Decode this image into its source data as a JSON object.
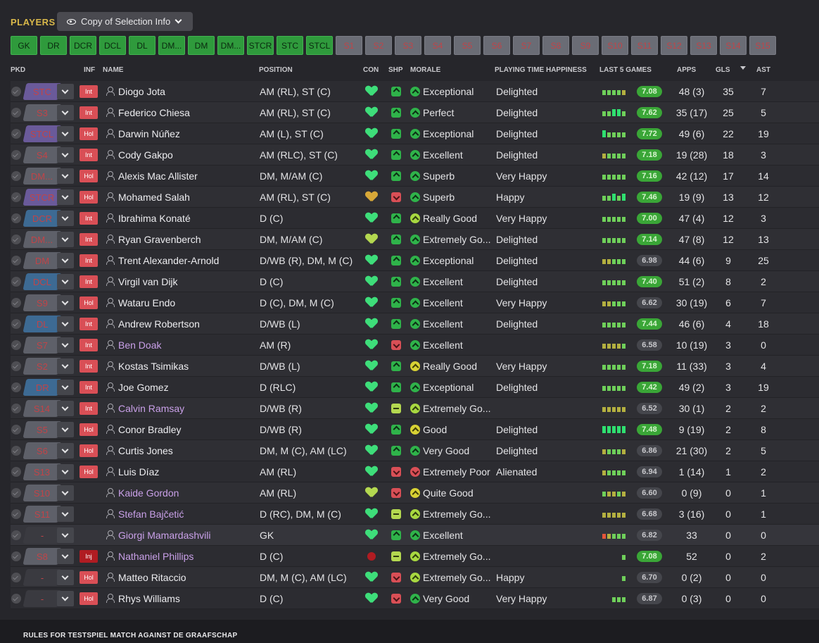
{
  "header_bar": {
    "title": "PLAYERS",
    "view_label": "Copy of Selection Info"
  },
  "positions": [
    "GK",
    "DR",
    "DCR",
    "DCL",
    "DL",
    "DM...",
    "DM",
    "DM...",
    "STCR",
    "STC",
    "STCL"
  ],
  "subs": [
    "S1",
    "S2",
    "S3",
    "S4",
    "S5",
    "S6",
    "S7",
    "S8",
    "S9",
    "S10",
    "S11",
    "S12",
    "S13",
    "S14",
    "S15"
  ],
  "columns": {
    "pkd": "PKD",
    "inf": "INF",
    "name": "NAME",
    "position": "POSITION",
    "con": "CON",
    "shp": "SHP",
    "morale": "MORALE",
    "pth": "PLAYING TIME HAPPINESS",
    "last5": "LAST 5 GAMES",
    "apps": "APPS",
    "gls": "GLS",
    "ast": "AST"
  },
  "colors": {
    "accent": "#d9b84a",
    "slot_green": "#2f9a3c",
    "slot_sub": "#6a6c75",
    "rating_good": "#3aa637",
    "loan_name": "#c9a0e8"
  },
  "players": [
    {
      "slot": "STC",
      "slot_color": "purple",
      "inf": "Int",
      "name": "Diogo Jota",
      "loan": false,
      "position": "AM (RL), ST (C)",
      "con": "green",
      "shp": "up",
      "mor_icon": "green",
      "morale": "Exceptional",
      "pth": "Delighted",
      "form": [
        4,
        4,
        4,
        4,
        3
      ],
      "rating": "7.08",
      "rating_good": true,
      "apps": "48 (3)",
      "gls": "35",
      "ast": "7"
    },
    {
      "slot": "S3",
      "slot_color": "grey",
      "inf": "Int",
      "name": "Federico Chiesa",
      "loan": false,
      "position": "AM (RL), ST (C)",
      "con": "green",
      "shp": "up",
      "mor_icon": "green",
      "morale": "Perfect",
      "pth": "Delighted",
      "form": [
        4,
        4,
        5,
        5,
        4
      ],
      "rating": "7.62",
      "rating_good": true,
      "apps": "35 (17)",
      "gls": "25",
      "ast": "5"
    },
    {
      "slot": "STCL",
      "slot_color": "purple",
      "inf": "Hol",
      "name": "Darwin Núñez",
      "loan": false,
      "position": "AM (L), ST (C)",
      "con": "green",
      "shp": "up",
      "mor_icon": "green",
      "morale": "Exceptional",
      "pth": "Delighted",
      "form": [
        5,
        4,
        4,
        4,
        4
      ],
      "rating": "7.72",
      "rating_good": true,
      "apps": "49 (6)",
      "gls": "22",
      "ast": "19"
    },
    {
      "slot": "S4",
      "slot_color": "grey",
      "inf": "Int",
      "name": "Cody Gakpo",
      "loan": false,
      "position": "AM (RLC), ST (C)",
      "con": "green",
      "shp": "up",
      "mor_icon": "green",
      "morale": "Excellent",
      "pth": "Delighted",
      "form": [
        3,
        4,
        4,
        4,
        4
      ],
      "rating": "7.18",
      "rating_good": true,
      "apps": "19 (28)",
      "gls": "18",
      "ast": "3"
    },
    {
      "slot": "DM...",
      "slot_color": "grey",
      "inf": "Hol",
      "name": "Alexis Mac Allister",
      "loan": false,
      "position": "DM, M/AM (C)",
      "con": "green",
      "shp": "up",
      "mor_icon": "green",
      "morale": "Superb",
      "pth": "Very Happy",
      "form": [
        4,
        4,
        4,
        4,
        4
      ],
      "rating": "7.16",
      "rating_good": true,
      "apps": "42 (12)",
      "gls": "17",
      "ast": "14"
    },
    {
      "slot": "STCR",
      "slot_color": "purple",
      "inf": "Hol",
      "name": "Mohamed Salah",
      "loan": false,
      "position": "AM (RL), ST (C)",
      "con": "gold",
      "shp": "down",
      "mor_icon": "green",
      "morale": "Superb",
      "pth": "Happy",
      "form": [
        4,
        4,
        5,
        4,
        5
      ],
      "rating": "7.46",
      "rating_good": true,
      "apps": "19 (9)",
      "gls": "13",
      "ast": "12"
    },
    {
      "slot": "DCR",
      "slot_color": "blue",
      "inf": "Int",
      "name": "Ibrahima Konaté",
      "loan": false,
      "position": "D (C)",
      "con": "green",
      "shp": "up",
      "mor_icon": "lime",
      "morale": "Really Good",
      "pth": "Very Happy",
      "form": [
        4,
        4,
        4,
        4,
        4
      ],
      "rating": "7.00",
      "rating_good": true,
      "apps": "47 (4)",
      "gls": "12",
      "ast": "3"
    },
    {
      "slot": "DM...",
      "slot_color": "grey",
      "inf": "Int",
      "name": "Ryan Gravenberch",
      "loan": false,
      "position": "DM, M/AM (C)",
      "con": "mid",
      "shp": "up",
      "mor_icon": "green",
      "morale": "Extremely Go...",
      "pth": "Delighted",
      "form": [
        4,
        4,
        4,
        4,
        4
      ],
      "rating": "7.14",
      "rating_good": true,
      "apps": "47 (8)",
      "gls": "12",
      "ast": "13"
    },
    {
      "slot": "DM",
      "slot_color": "grey",
      "inf": "Int",
      "name": "Trent Alexander-Arnold",
      "loan": false,
      "position": "D/WB (R), DM, M (C)",
      "con": "green",
      "shp": "up",
      "mor_icon": "green",
      "morale": "Exceptional",
      "pth": "Delighted",
      "form": [
        3,
        3,
        4,
        4,
        4
      ],
      "rating": "6.98",
      "rating_good": false,
      "apps": "44 (6)",
      "gls": "9",
      "ast": "25"
    },
    {
      "slot": "DCL",
      "slot_color": "blue",
      "inf": "Int",
      "name": "Virgil van Dijk",
      "loan": false,
      "position": "D (C)",
      "con": "green",
      "shp": "up",
      "mor_icon": "green",
      "morale": "Excellent",
      "pth": "Delighted",
      "form": [
        4,
        4,
        4,
        4,
        4
      ],
      "rating": "7.40",
      "rating_good": true,
      "apps": "51 (2)",
      "gls": "8",
      "ast": "2"
    },
    {
      "slot": "S9",
      "slot_color": "grey",
      "inf": "Hol",
      "name": "Wataru Endo",
      "loan": false,
      "position": "D (C), DM, M (C)",
      "con": "green",
      "shp": "up",
      "mor_icon": "green",
      "morale": "Excellent",
      "pth": "Very Happy",
      "form": [
        3,
        3,
        4,
        4,
        4
      ],
      "rating": "6.62",
      "rating_good": false,
      "apps": "30 (19)",
      "gls": "6",
      "ast": "7"
    },
    {
      "slot": "DL",
      "slot_color": "blue",
      "inf": "Int",
      "name": "Andrew Robertson",
      "loan": false,
      "position": "D/WB (L)",
      "con": "green",
      "shp": "up",
      "mor_icon": "green",
      "morale": "Excellent",
      "pth": "Delighted",
      "form": [
        4,
        4,
        4,
        4,
        4
      ],
      "rating": "7.44",
      "rating_good": true,
      "apps": "46 (6)",
      "gls": "4",
      "ast": "18"
    },
    {
      "slot": "S7",
      "slot_color": "grey",
      "inf": "Int",
      "name": "Ben Doak",
      "loan": true,
      "position": "AM (R)",
      "con": "green",
      "shp": "down",
      "mor_icon": "green",
      "morale": "Excellent",
      "pth": "",
      "form": [
        3,
        3,
        3,
        3,
        4
      ],
      "rating": "6.58",
      "rating_good": false,
      "apps": "10 (19)",
      "gls": "3",
      "ast": "0"
    },
    {
      "slot": "S2",
      "slot_color": "grey",
      "inf": "Int",
      "name": "Kostas Tsimikas",
      "loan": false,
      "position": "D/WB (L)",
      "con": "green",
      "shp": "up",
      "mor_icon": "yel",
      "morale": "Really Good",
      "pth": "Very Happy",
      "form": [
        4,
        4,
        4,
        4,
        4
      ],
      "rating": "7.18",
      "rating_good": true,
      "apps": "11 (33)",
      "gls": "3",
      "ast": "4"
    },
    {
      "slot": "DR",
      "slot_color": "blue",
      "inf": "Int",
      "name": "Joe Gomez",
      "loan": false,
      "position": "D (RLC)",
      "con": "green",
      "shp": "up",
      "mor_icon": "green",
      "morale": "Exceptional",
      "pth": "Delighted",
      "form": [
        4,
        4,
        4,
        4,
        4
      ],
      "rating": "7.42",
      "rating_good": true,
      "apps": "49 (2)",
      "gls": "3",
      "ast": "19"
    },
    {
      "slot": "S14",
      "slot_color": "grey",
      "inf": "Int",
      "name": "Calvin Ramsay",
      "loan": true,
      "position": "D/WB (R)",
      "con": "green",
      "shp": "mid",
      "mor_icon": "lime",
      "morale": "Extremely Go...",
      "pth": "",
      "form": [
        3,
        3,
        3,
        3,
        3
      ],
      "rating": "6.52",
      "rating_good": false,
      "apps": "30 (1)",
      "gls": "2",
      "ast": "2"
    },
    {
      "slot": "S5",
      "slot_color": "grey",
      "inf": "Hol",
      "name": "Conor Bradley",
      "loan": false,
      "position": "D/WB (R)",
      "con": "green",
      "shp": "up",
      "mor_icon": "yel",
      "morale": "Good",
      "pth": "Delighted",
      "form": [
        5,
        5,
        5,
        5,
        5
      ],
      "rating": "7.48",
      "rating_good": true,
      "apps": "9 (19)",
      "gls": "2",
      "ast": "8"
    },
    {
      "slot": "S6",
      "slot_color": "grey",
      "inf": "Hol",
      "name": "Curtis Jones",
      "loan": false,
      "position": "DM, M (C), AM (LC)",
      "con": "green",
      "shp": "up",
      "mor_icon": "green",
      "morale": "Very Good",
      "pth": "Delighted",
      "form": [
        3,
        4,
        4,
        4,
        3
      ],
      "rating": "6.86",
      "rating_good": false,
      "apps": "21 (30)",
      "gls": "2",
      "ast": "5"
    },
    {
      "slot": "S13",
      "slot_color": "grey",
      "inf": "Hol",
      "name": "Luis Díaz",
      "loan": false,
      "position": "AM (RL)",
      "con": "green",
      "shp": "down",
      "mor_icon": "red",
      "morale": "Extremely Poor",
      "pth": "Alienated",
      "form": [
        3,
        4,
        4,
        4,
        4
      ],
      "rating": "6.94",
      "rating_good": false,
      "apps": "1 (14)",
      "gls": "1",
      "ast": "2"
    },
    {
      "slot": "S10",
      "slot_color": "grey",
      "inf": "",
      "name": "Kaide Gordon",
      "loan": true,
      "position": "AM (RL)",
      "con": "mid",
      "shp": "down",
      "mor_icon": "yel",
      "morale": "Quite Good",
      "pth": "",
      "form": [
        4,
        3,
        3,
        4,
        3
      ],
      "rating": "6.60",
      "rating_good": false,
      "apps": "0 (9)",
      "gls": "0",
      "ast": "1"
    },
    {
      "slot": "S11",
      "slot_color": "grey",
      "inf": "",
      "name": "Stefan Bajčetić",
      "loan": true,
      "position": "D (RC), DM, M (C)",
      "con": "green",
      "shp": "mid",
      "mor_icon": "lime",
      "morale": "Extremely Go...",
      "pth": "",
      "form": [
        3,
        3,
        3,
        3,
        3
      ],
      "rating": "6.68",
      "rating_good": false,
      "apps": "3 (16)",
      "gls": "0",
      "ast": "1"
    },
    {
      "slot": "-",
      "slot_color": "none",
      "inf": "",
      "name": "Giorgi Mamardashvili",
      "loan": true,
      "position": "GK",
      "con": "green",
      "shp": "up",
      "mor_icon": "green",
      "morale": "Excellent",
      "pth": "",
      "form": [
        2,
        3,
        4,
        4,
        4
      ],
      "rating": "6.82",
      "rating_good": false,
      "apps": "33",
      "gls": "0",
      "ast": "0"
    },
    {
      "slot": "S8",
      "slot_color": "grey",
      "inf": "Inj",
      "name": "Nathaniel Phillips",
      "loan": true,
      "position": "D (C)",
      "con": "inj",
      "shp": "mid",
      "mor_icon": "lime",
      "morale": "Extremely Go...",
      "pth": "",
      "form": [
        0,
        0,
        0,
        0,
        4
      ],
      "rating": "7.08",
      "rating_good": true,
      "apps": "52",
      "gls": "0",
      "ast": "2"
    },
    {
      "slot": "-",
      "slot_color": "none",
      "inf": "Hol",
      "name": "Matteo Ritaccio",
      "loan": false,
      "position": "DM, M (C), AM (LC)",
      "con": "green",
      "shp": "down",
      "mor_icon": "lime",
      "morale": "Extremely Go...",
      "pth": "Happy",
      "form": [
        0,
        0,
        0,
        0,
        4
      ],
      "rating": "6.70",
      "rating_good": false,
      "apps": "0 (2)",
      "gls": "0",
      "ast": "0"
    },
    {
      "slot": "-",
      "slot_color": "none",
      "inf": "Hol",
      "name": "Rhys Williams",
      "loan": false,
      "position": "D (C)",
      "con": "green",
      "shp": "down",
      "mor_icon": "green",
      "morale": "Very Good",
      "pth": "Very Happy",
      "form": [
        0,
        0,
        4,
        4,
        4
      ],
      "rating": "6.87",
      "rating_good": false,
      "apps": "0 (3)",
      "gls": "0",
      "ast": "0"
    }
  ],
  "footer": {
    "text": "RULES FOR TESTSPIEL MATCH AGAINST DE GRAAFSCHAP"
  }
}
